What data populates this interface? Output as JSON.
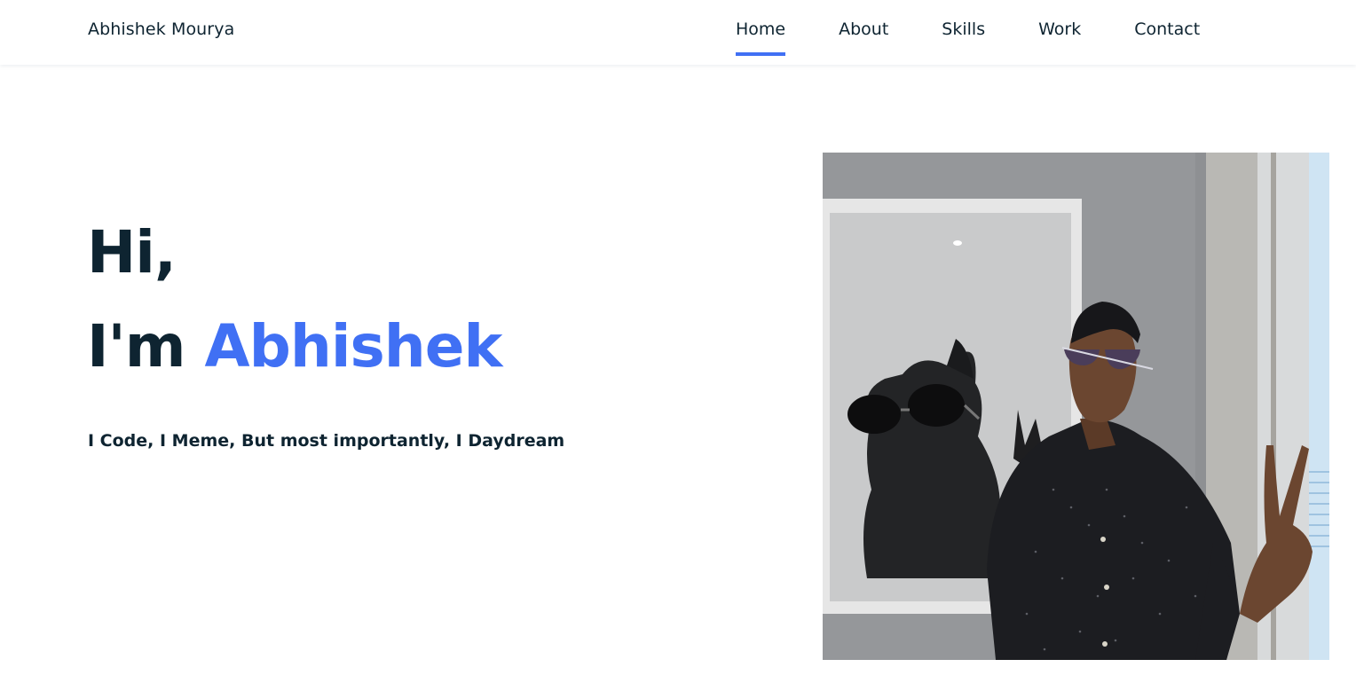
{
  "header": {
    "logo": "Abhishek Mourya",
    "nav": [
      {
        "label": "Home",
        "active": true
      },
      {
        "label": "About",
        "active": false
      },
      {
        "label": "Skills",
        "active": false
      },
      {
        "label": "Work",
        "active": false
      },
      {
        "label": "Contact",
        "active": false
      }
    ]
  },
  "hero": {
    "line1": "Hi,",
    "line2_prefix": "I'm ",
    "line2_name": "Abhishek",
    "tagline": "I Code, I Meme, But most importantly, I Daydream"
  },
  "colors": {
    "accent": "#4070f4",
    "text": "#0e2431",
    "background": "#ffffff"
  }
}
